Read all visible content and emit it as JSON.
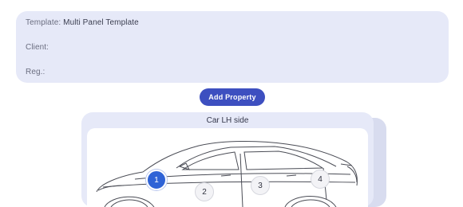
{
  "info": {
    "template_label": "Template:",
    "template_value": "Multi Panel Template",
    "client_label": "Client:",
    "client_value": "",
    "reg_label": "Reg.:",
    "reg_value": ""
  },
  "actions": {
    "add_property_label": "Add Property"
  },
  "panel": {
    "title": "Car LH side",
    "markers": [
      "1",
      "2",
      "3",
      "4"
    ],
    "active_marker": "1"
  },
  "colors": {
    "accent": "#3d4fc0",
    "active_marker": "#2f63d6",
    "card_background": "#e6e9f8"
  }
}
